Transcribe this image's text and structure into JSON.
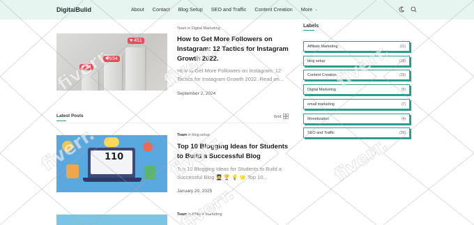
{
  "header": {
    "logo": "DigitalBulid",
    "nav": [
      "About",
      "Contact",
      "Blog Setup",
      "SEO and Traffic",
      "Content Creation"
    ],
    "more_label": "More"
  },
  "featured": {
    "author": "Team",
    "in_word": "in",
    "category": "Digital Marketing",
    "title": "How to Get More Followers on Instagram: 12 Tactics for Instagram Growth 2022.",
    "excerpt": "How to Get More Followers on Instagram: 12 Tactics for Instagram Growth 2022. Read on...",
    "date": "September 2, 2024",
    "badges": [
      "451",
      "154",
      "54"
    ]
  },
  "latest": {
    "heading": "Latest Posts",
    "grid_label": "Grid"
  },
  "posts": [
    {
      "author": "Team",
      "in_word": "in",
      "category": "blog setup",
      "title": "Top 10 Blogging Ideas for Students to Build a Successful Blog",
      "excerpt": "Top 10 Blogging Ideas for Students to Build a Successful Blog 🧑‍🎓 🏆 💡 🌟 Top 10...",
      "date": "January 20, 2025",
      "image_text": "110"
    },
    {
      "author": "Team",
      "in_word": "in",
      "category": "Affiliate Marketing"
    }
  ],
  "sidebar": {
    "heading": "Labels",
    "labels": [
      {
        "name": "Affiliate Marketing",
        "count": "(11)"
      },
      {
        "name": "blog setup",
        "count": "(18)"
      },
      {
        "name": "Content Creation",
        "count": "(25)"
      },
      {
        "name": "Digital Marketing",
        "count": "(5)"
      },
      {
        "name": "email marketing",
        "count": "(7)"
      },
      {
        "name": "Monetization",
        "count": "(4)"
      },
      {
        "name": "SEO and Traffic",
        "count": "(39)"
      }
    ]
  },
  "watermark": "fiverr.",
  "colors": {
    "accent": "#2a9d8f",
    "header_bg": "#e7f5f1",
    "badge": "#e94a5a"
  }
}
